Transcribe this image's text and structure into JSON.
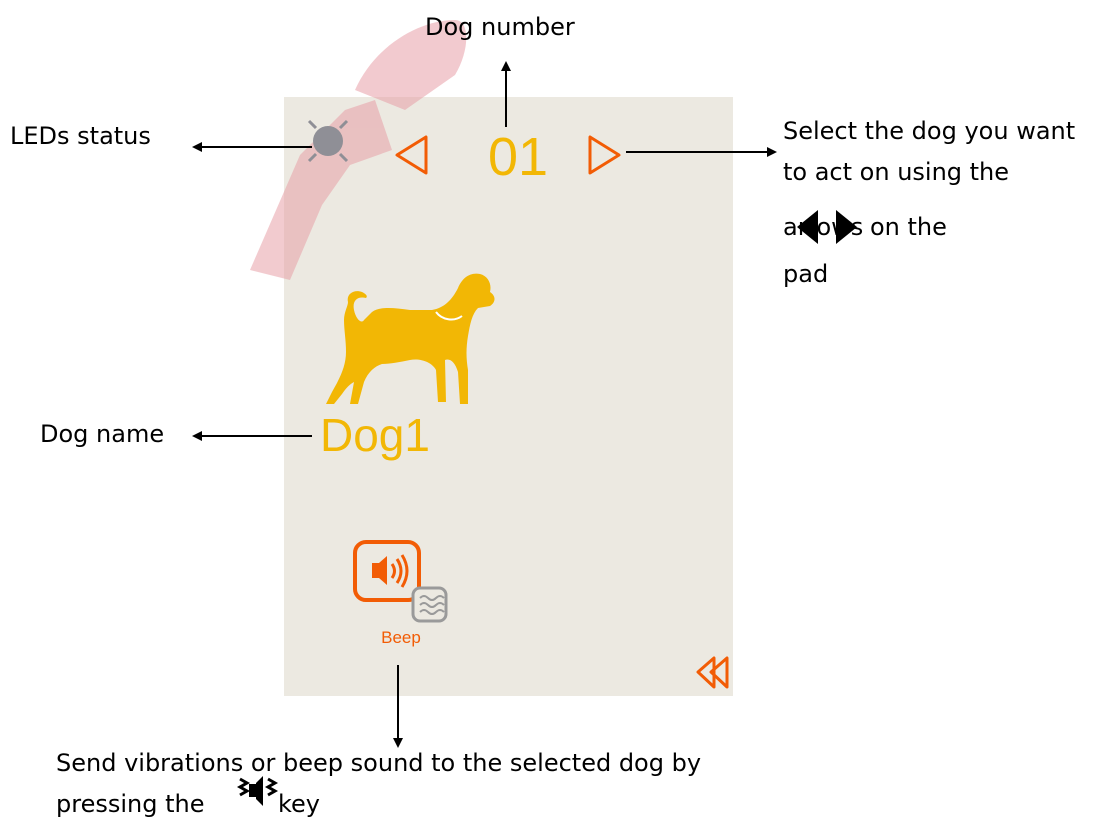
{
  "screen": {
    "dog_number": "01",
    "dog_name": "Dog1",
    "beep_label": "Beep",
    "colors": {
      "accent": "#F25C05",
      "dog": "#F2B705",
      "background": "#ECE9E1",
      "led": "#8F8F96"
    }
  },
  "callouts": {
    "dog_number": "Dog number",
    "leds_status": "LEDs status",
    "select_line1": "Select the dog you want",
    "select_line2": "to act on using the",
    "select_line3_a": "arrows",
    "select_line3_b": "on the",
    "select_line4": "pad",
    "dog_name": "Dog name",
    "send_line1": "Send vibrations or beep sound to the selected dog by",
    "send_line2_a": "pressing the",
    "send_line2_b": "key"
  },
  "icons": [
    "led-icon",
    "prev-arrow-icon",
    "next-arrow-icon",
    "dog-icon",
    "speaker-icon",
    "vibration-icon",
    "back-icon",
    "key-icon"
  ]
}
